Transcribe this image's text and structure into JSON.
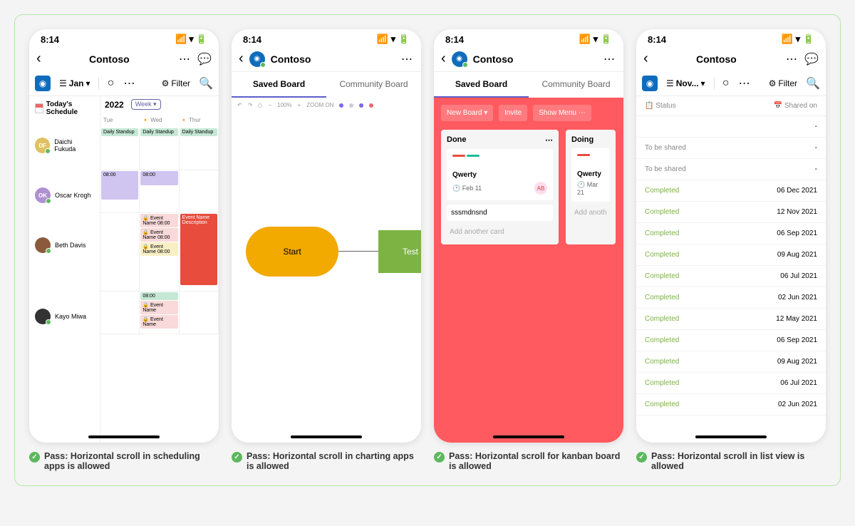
{
  "time": "8:14",
  "app_title": "Contoso",
  "tabs": {
    "saved": "Saved Board",
    "community": "Community Board"
  },
  "filter": "Filter",
  "screen1": {
    "month": "Jan",
    "schedule_title": "Today's Schedule",
    "year": "2022",
    "week_btn": "Week",
    "days": [
      "Tue",
      "Wed",
      "Thur"
    ],
    "people": [
      "Daichi Fukuda",
      "Oscar Krogh",
      "Beth Davis",
      "Kayo Miwa"
    ],
    "ev_standup": "Daily Standup",
    "ev_name": "Event Name",
    "ev_desc": "Description",
    "caption": "Pass: Horizontal scroll in scheduling apps is allowed"
  },
  "screen2": {
    "zoom_pct": "100%",
    "zoom_on": "ZOOM ON",
    "node_start": "Start",
    "node_test": "Test",
    "caption": "Pass: Horizontal scroll in charting apps is allowed"
  },
  "screen3": {
    "btn_new": "New Board",
    "btn_invite": "Invite",
    "btn_menu": "Show Menu",
    "col_done": "Done",
    "col_doing": "Doing",
    "card_title": "Qwerty",
    "date1": "Feb 11",
    "date2": "Mar 21",
    "av": "AB",
    "card2": "sssmdnsnd",
    "add": "Add another card",
    "add2": "Add anoth",
    "caption": "Pass: Horizontal scroll for kanban board is allowed"
  },
  "screen4": {
    "month": "Nov...",
    "col_status": "Status",
    "col_shared": "Shared on",
    "rows": [
      {
        "status": "",
        "date": "-"
      },
      {
        "status": "To be shared",
        "date": "-"
      },
      {
        "status": "To be shared",
        "date": "-"
      },
      {
        "status": "Completed",
        "date": "06 Dec 2021"
      },
      {
        "status": "Completed",
        "date": "12 Nov 2021"
      },
      {
        "status": "Completed",
        "date": "06 Sep 2021"
      },
      {
        "status": "Completed",
        "date": "09 Aug 2021"
      },
      {
        "status": "Completed",
        "date": "06 Jul 2021"
      },
      {
        "status": "Completed",
        "date": "02 Jun 2021"
      },
      {
        "status": "Completed",
        "date": "12 May 2021"
      },
      {
        "status": "Completed",
        "date": "06 Sep 2021"
      },
      {
        "status": "Completed",
        "date": "09 Aug 2021"
      },
      {
        "status": "Completed",
        "date": "06 Jul 2021"
      },
      {
        "status": "Completed",
        "date": "02 Jun 2021"
      }
    ],
    "caption": "Pass: Horizontal scroll in list view is allowed"
  }
}
